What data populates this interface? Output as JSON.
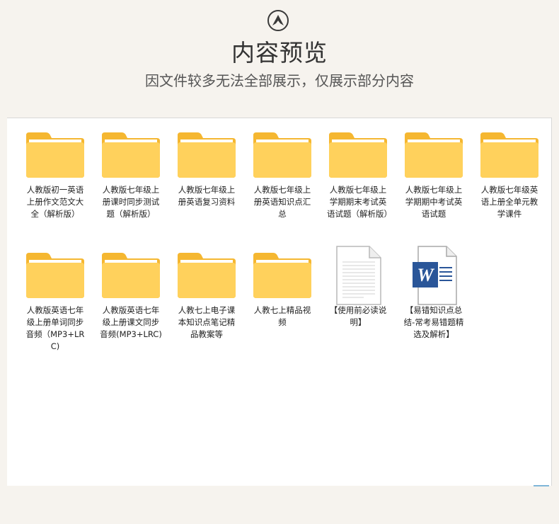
{
  "header": {
    "title": "内容预览",
    "subtitle": "因文件较多无法全部展示，仅展示部分内容"
  },
  "items": [
    {
      "type": "folder",
      "label": "人教版初一英语上册作文范文大全（解析版）"
    },
    {
      "type": "folder",
      "label": "人教版七年级上册课时同步测试题（解析版）"
    },
    {
      "type": "folder",
      "label": "人教版七年级上册英语复习资料"
    },
    {
      "type": "folder",
      "label": "人教版七年级上册英语知识点汇总"
    },
    {
      "type": "folder",
      "label": "人教版七年级上学期期末考试英语试题（解析版）"
    },
    {
      "type": "folder",
      "label": "人教版七年级上学期期中考试英语试题"
    },
    {
      "type": "folder",
      "label": "人教版七年级英语上册全单元教学课件"
    },
    {
      "type": "folder",
      "label": "人教版英语七年级上册单词同步音频（MP3+LRC)"
    },
    {
      "type": "folder",
      "label": "人教版英语七年级上册课文同步音频(MP3+LRC)"
    },
    {
      "type": "folder",
      "label": "人教七上电子课本知识点笔记精品教案等"
    },
    {
      "type": "folder",
      "label": "人教七上精品视频"
    },
    {
      "type": "text-doc",
      "label": "【使用前必读说明】"
    },
    {
      "type": "word-doc",
      "label": "【易错知识点总结-常考易错题精选及解析】"
    }
  ],
  "colors": {
    "folder_front": "#ffd15c",
    "folder_back": "#f5b731",
    "word_blue": "#2a5699"
  }
}
